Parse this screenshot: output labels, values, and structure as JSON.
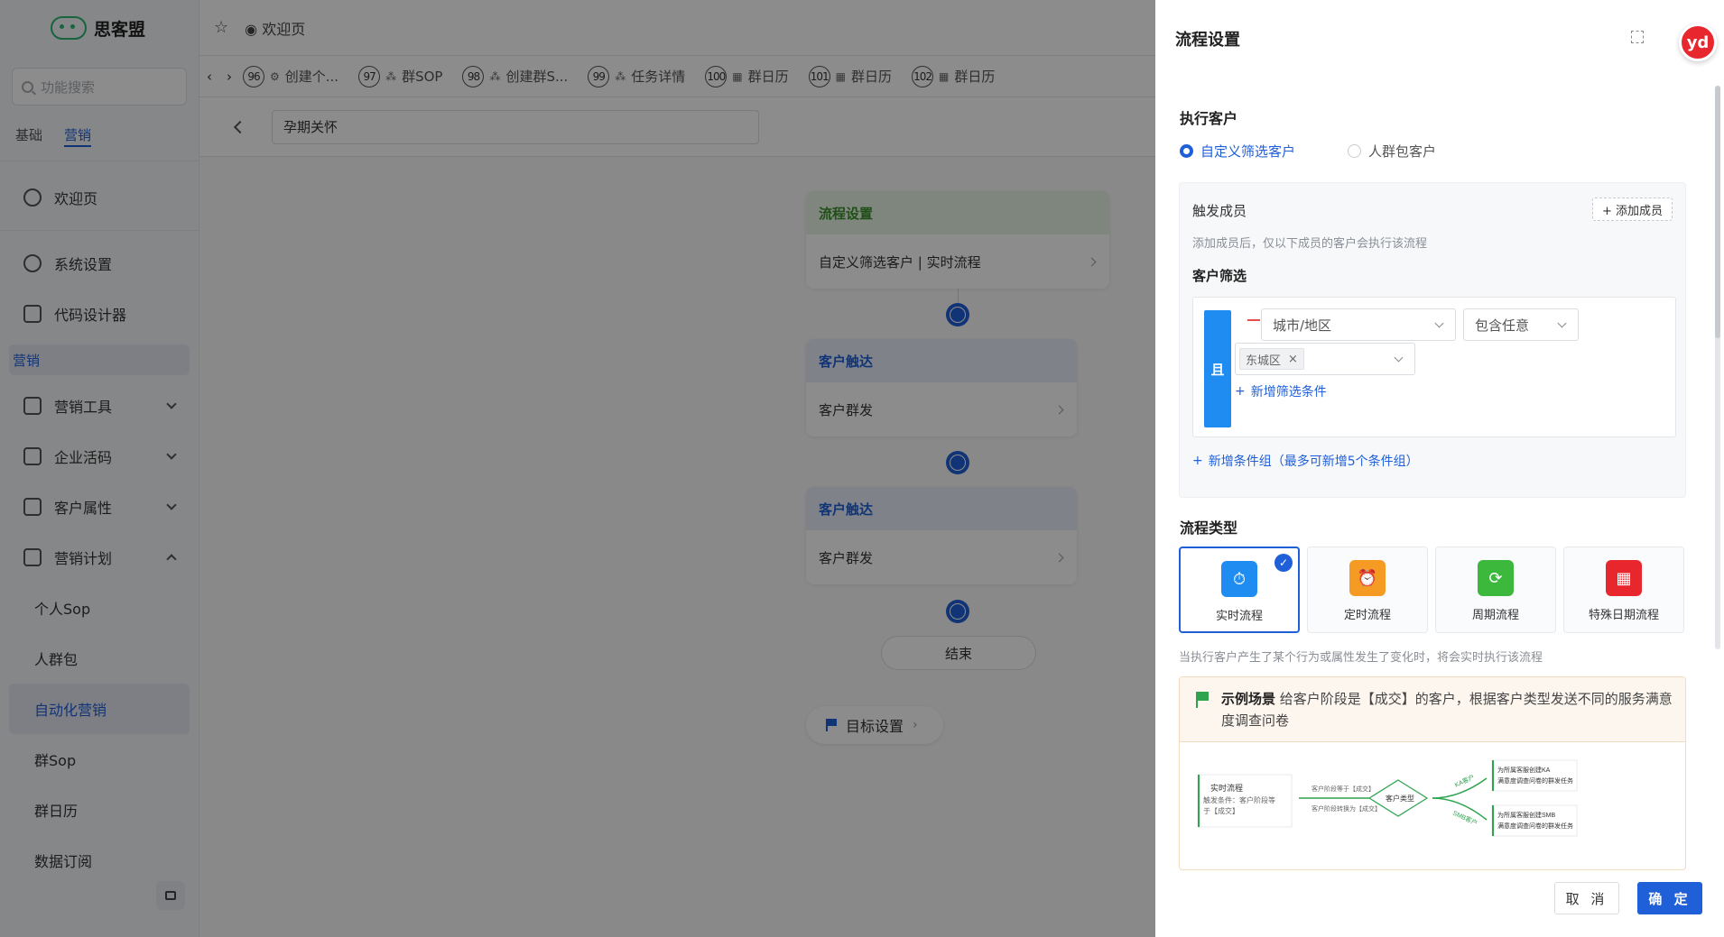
{
  "app": {
    "name": "思客盟"
  },
  "sidebar": {
    "search_placeholder": "功能搜索",
    "tabs": [
      "基础",
      "营销"
    ],
    "welcome": "欢迎页",
    "system_settings": "系统设置",
    "code_designer": "代码设计器",
    "group_label": "营销",
    "marketing_tools": "营销工具",
    "enterprise_code": "企业活码",
    "customer_attributes": "客户属性",
    "marketing_plan": "营销计划",
    "sub_items": [
      "个人Sop",
      "人群包",
      "自动化营销",
      "群Sop",
      "群日历",
      "数据订阅"
    ]
  },
  "topbar": {
    "welcome_tab": "欢迎页"
  },
  "tabbar": {
    "tabs": [
      {
        "num": "96",
        "label": "创建个..."
      },
      {
        "num": "97",
        "label": "群SOP"
      },
      {
        "num": "98",
        "label": "创建群S..."
      },
      {
        "num": "99",
        "label": "任务详情"
      },
      {
        "num": "100",
        "label": "群日历"
      },
      {
        "num": "101",
        "label": "群日历"
      },
      {
        "num": "102",
        "label": "群日历"
      }
    ]
  },
  "content": {
    "flow_name": "孕期关怀",
    "nodes": {
      "flow_settings_head": "流程设置",
      "flow_settings_body": "自定义筛选客户 | 实时流程",
      "reach1_head": "客户触达",
      "reach1_body": "客户群发",
      "reach2_head": "客户触达",
      "reach2_body": "客户群发",
      "end": "结束",
      "goal": "目标设置"
    }
  },
  "drawer": {
    "title": "流程设置",
    "avatar_text": "yd",
    "exec_title": "执行客户",
    "radio_custom": "自定义筛选客户",
    "radio_crowd": "人群包客户",
    "trigger_title": "触发成员",
    "add_member": "+ 添加成员",
    "trigger_hint": "添加成员后，仅以下成员的客户会执行该流程",
    "filter_title": "客户筛选",
    "and_label": "且",
    "field_select": "城市/地区",
    "op_select": "包含任意",
    "tag_value": "东城区",
    "add_condition": "新增筛选条件",
    "add_group": "新增条件组（最多可新增5个条件组）",
    "type_title": "流程类型",
    "types": [
      {
        "label": "实时流程",
        "color": "#1e8cf0"
      },
      {
        "label": "定时流程",
        "color": "#f59a23"
      },
      {
        "label": "周期流程",
        "color": "#3cb83c"
      },
      {
        "label": "特殊日期流程",
        "color": "#e8262e"
      }
    ],
    "type_desc": "当执行客户产生了某个行为或属性发生了变化时，将会实时执行该流程",
    "example_title": "示例场景",
    "example_text": "给客户阶段是【成交】的客户，根据客户类型发送不同的服务满意度调查问卷",
    "diagram": {
      "start_title": "实时流程",
      "start_desc1": "触发条件：客户阶段等",
      "start_desc2": "于【成交】",
      "edge_top": "客户阶段等于【成交】",
      "edge_bottom": "客户阶段转换为【成交】",
      "decision": "客户类型",
      "branch_ka": "KA客户",
      "branch_smb": "SMB客户",
      "out1_line1": "为所属客服创建KA",
      "out1_line2": "满意度调查问卷的群发任务",
      "out2_line1": "为所属客服创建SMB",
      "out2_line2": "满意度调查问卷的群发任务"
    },
    "cancel": "取 消",
    "confirm": "确 定"
  }
}
